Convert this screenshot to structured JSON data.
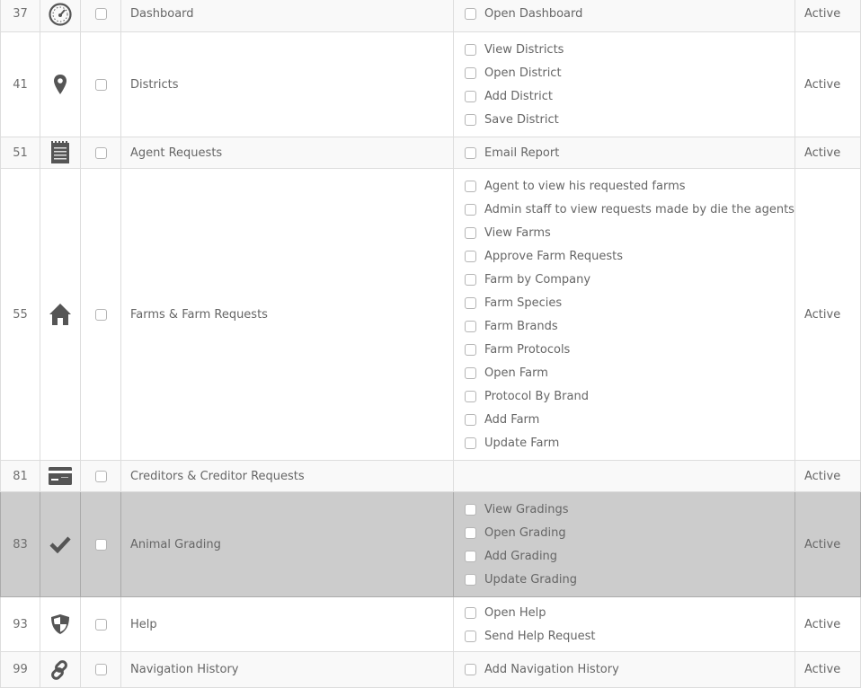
{
  "status_text": "Active",
  "rows": [
    {
      "id": "37",
      "icon": "dashboard-gauge-icon",
      "name": "Dashboard",
      "permissions": [
        "Open Dashboard"
      ],
      "status": "Active"
    },
    {
      "id": "41",
      "icon": "map-pin-icon",
      "name": "Districts",
      "permissions": [
        "View Districts",
        "Open District",
        "Add District",
        "Save District"
      ],
      "status": "Active"
    },
    {
      "id": "51",
      "icon": "notepad-icon",
      "name": "Agent Requests",
      "permissions": [
        "Email Report"
      ],
      "status": "Active"
    },
    {
      "id": "55",
      "icon": "home-icon",
      "name": "Farms & Farm Requests",
      "permissions": [
        "Agent to view his requested farms",
        "Admin staff to view requests made by die the agents",
        "View Farms",
        "Approve Farm Requests",
        "Farm by Company",
        "Farm Species",
        "Farm Brands",
        "Farm Protocols",
        "Open Farm",
        "Protocol By Brand",
        "Add Farm",
        "Update Farm"
      ],
      "status": "Active"
    },
    {
      "id": "81",
      "icon": "credit-card-icon",
      "name": "Creditors & Creditor Requests",
      "permissions": [],
      "status": "Active"
    },
    {
      "id": "83",
      "icon": "checkmark-icon",
      "name": "Animal Grading",
      "permissions": [
        "View Gradings",
        "Open Grading",
        "Add Grading",
        "Update Grading"
      ],
      "status": "Active"
    },
    {
      "id": "93",
      "icon": "shield-icon",
      "name": "Help",
      "permissions": [
        "Open Help",
        "Send Help Request"
      ],
      "status": "Active"
    },
    {
      "id": "99",
      "icon": "link-icon",
      "name": "Navigation History",
      "permissions": [
        "Add Navigation History"
      ],
      "status": "Active"
    }
  ]
}
